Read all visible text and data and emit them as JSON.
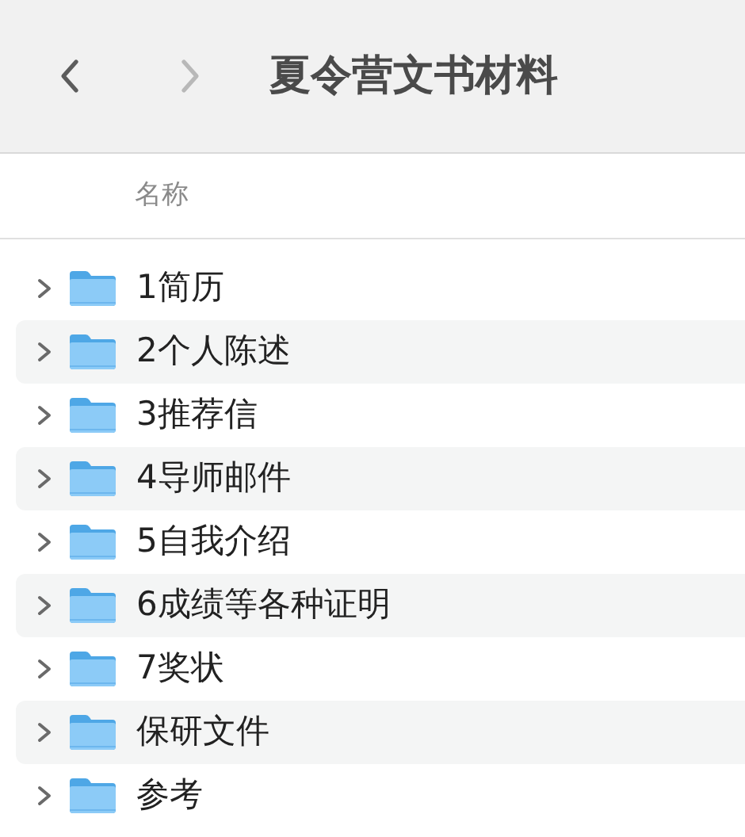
{
  "toolbar": {
    "back": {
      "disabled": false
    },
    "forward": {
      "disabled": true
    },
    "title": "夏令营文书材料"
  },
  "table": {
    "columns": [
      "名称"
    ],
    "rows": [
      {
        "name": "1简历",
        "expanded": false
      },
      {
        "name": "2个人陈述",
        "expanded": false
      },
      {
        "name": "3推荐信",
        "expanded": false
      },
      {
        "name": "4导师邮件",
        "expanded": false
      },
      {
        "name": "5自我介绍",
        "expanded": false
      },
      {
        "name": "6成绩等各种证明",
        "expanded": false
      },
      {
        "name": "7奖状",
        "expanded": false
      },
      {
        "name": "保研文件",
        "expanded": false
      },
      {
        "name": "参考",
        "expanded": false
      }
    ]
  }
}
